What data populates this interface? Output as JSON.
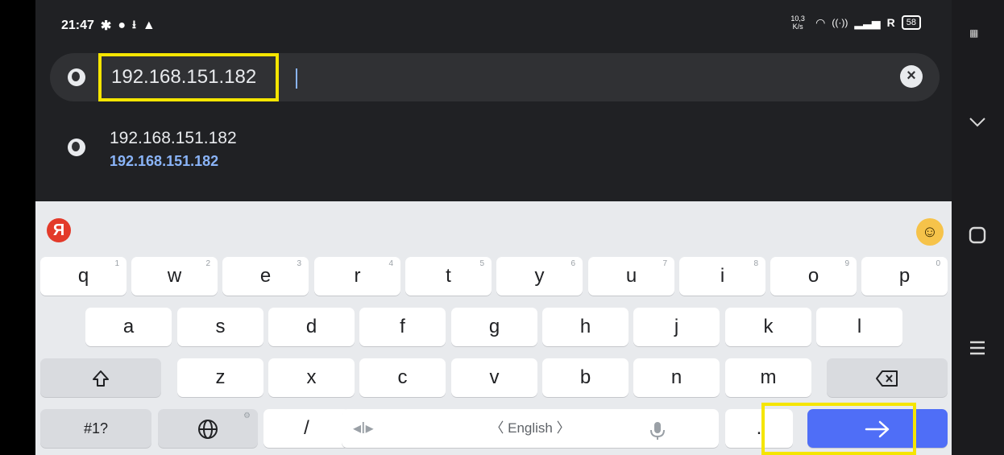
{
  "status_bar": {
    "time": "21:47",
    "network_speed": "10,3 K/s",
    "carrier": "R",
    "battery": "58"
  },
  "omnibox": {
    "url": "192.168.151.182"
  },
  "suggestions": [
    {
      "title": "192.168.151.182",
      "url": "192.168.151.182"
    }
  ],
  "keyboard": {
    "row1": [
      {
        "key": "q",
        "hint": "1"
      },
      {
        "key": "w",
        "hint": "2"
      },
      {
        "key": "e",
        "hint": "3"
      },
      {
        "key": "r",
        "hint": "4"
      },
      {
        "key": "t",
        "hint": "5"
      },
      {
        "key": "y",
        "hint": "6"
      },
      {
        "key": "u",
        "hint": "7"
      },
      {
        "key": "i",
        "hint": "8"
      },
      {
        "key": "o",
        "hint": "9"
      },
      {
        "key": "p",
        "hint": "0"
      }
    ],
    "row2": [
      "a",
      "s",
      "d",
      "f",
      "g",
      "h",
      "j",
      "k",
      "l"
    ],
    "row3": [
      "z",
      "x",
      "c",
      "v",
      "b",
      "n",
      "m"
    ],
    "symbols_label": "#1?",
    "slash_label": "/",
    "space_label": "〈 English 〉",
    "period_label": "."
  }
}
